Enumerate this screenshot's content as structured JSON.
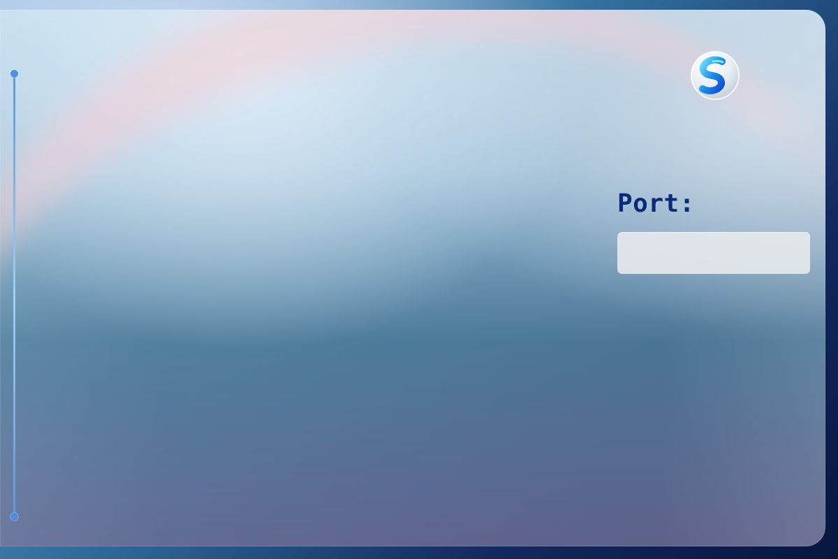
{
  "app": {
    "logo_icon": "swirl-s-logo"
  },
  "form": {
    "port_label": "Port:",
    "port_value": "",
    "port_placeholder": ""
  },
  "colors": {
    "label": "#062b78",
    "input_background": "#e5e8ec",
    "timeline": "#5f96d8"
  }
}
